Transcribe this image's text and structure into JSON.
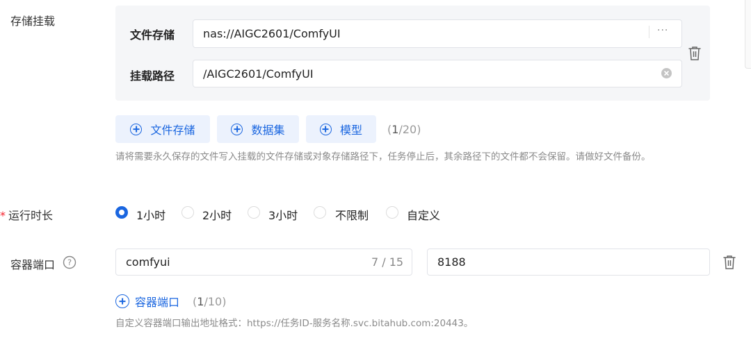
{
  "storage_mount": {
    "label": "存储挂载",
    "file_storage_label": "文件存储",
    "file_storage_value": "nas://AIGC2601/ComfyUI",
    "more_icon": "···",
    "mount_path_label": "挂载路径",
    "mount_path_value": "/AIGC2601/ComfyUI",
    "buttons": {
      "file_storage": "文件存储",
      "dataset": "数据集",
      "model": "模型"
    },
    "count_current": "1",
    "count_rest": "/20)",
    "count_open": "(",
    "hint": "请将需要永久保存的文件写入挂载的文件存储或对象存储路径下，任务停止后，其余路径下的文件都不会保留。请做好文件备份。"
  },
  "runtime": {
    "required_mark": "*",
    "label": "运行时长",
    "options": [
      "1小时",
      "2小时",
      "3小时",
      "不限制",
      "自定义"
    ],
    "selected": "1小时"
  },
  "container_port": {
    "label": "容器端口",
    "name_value": "comfyui",
    "name_counter": "7 / 15",
    "port_value": "8188",
    "add_button": "容器端口",
    "count_open": "(",
    "count_current": "1",
    "count_rest": "/10)",
    "hint": "自定义容器端口输出地址格式：https://任务ID-服务名称.svc.bitahub.com:20443。"
  },
  "colors": {
    "accent": "#1a66e0",
    "required": "#f5222d",
    "panel_bg": "#f5f6f8",
    "button_bg": "#ecf2fd"
  }
}
